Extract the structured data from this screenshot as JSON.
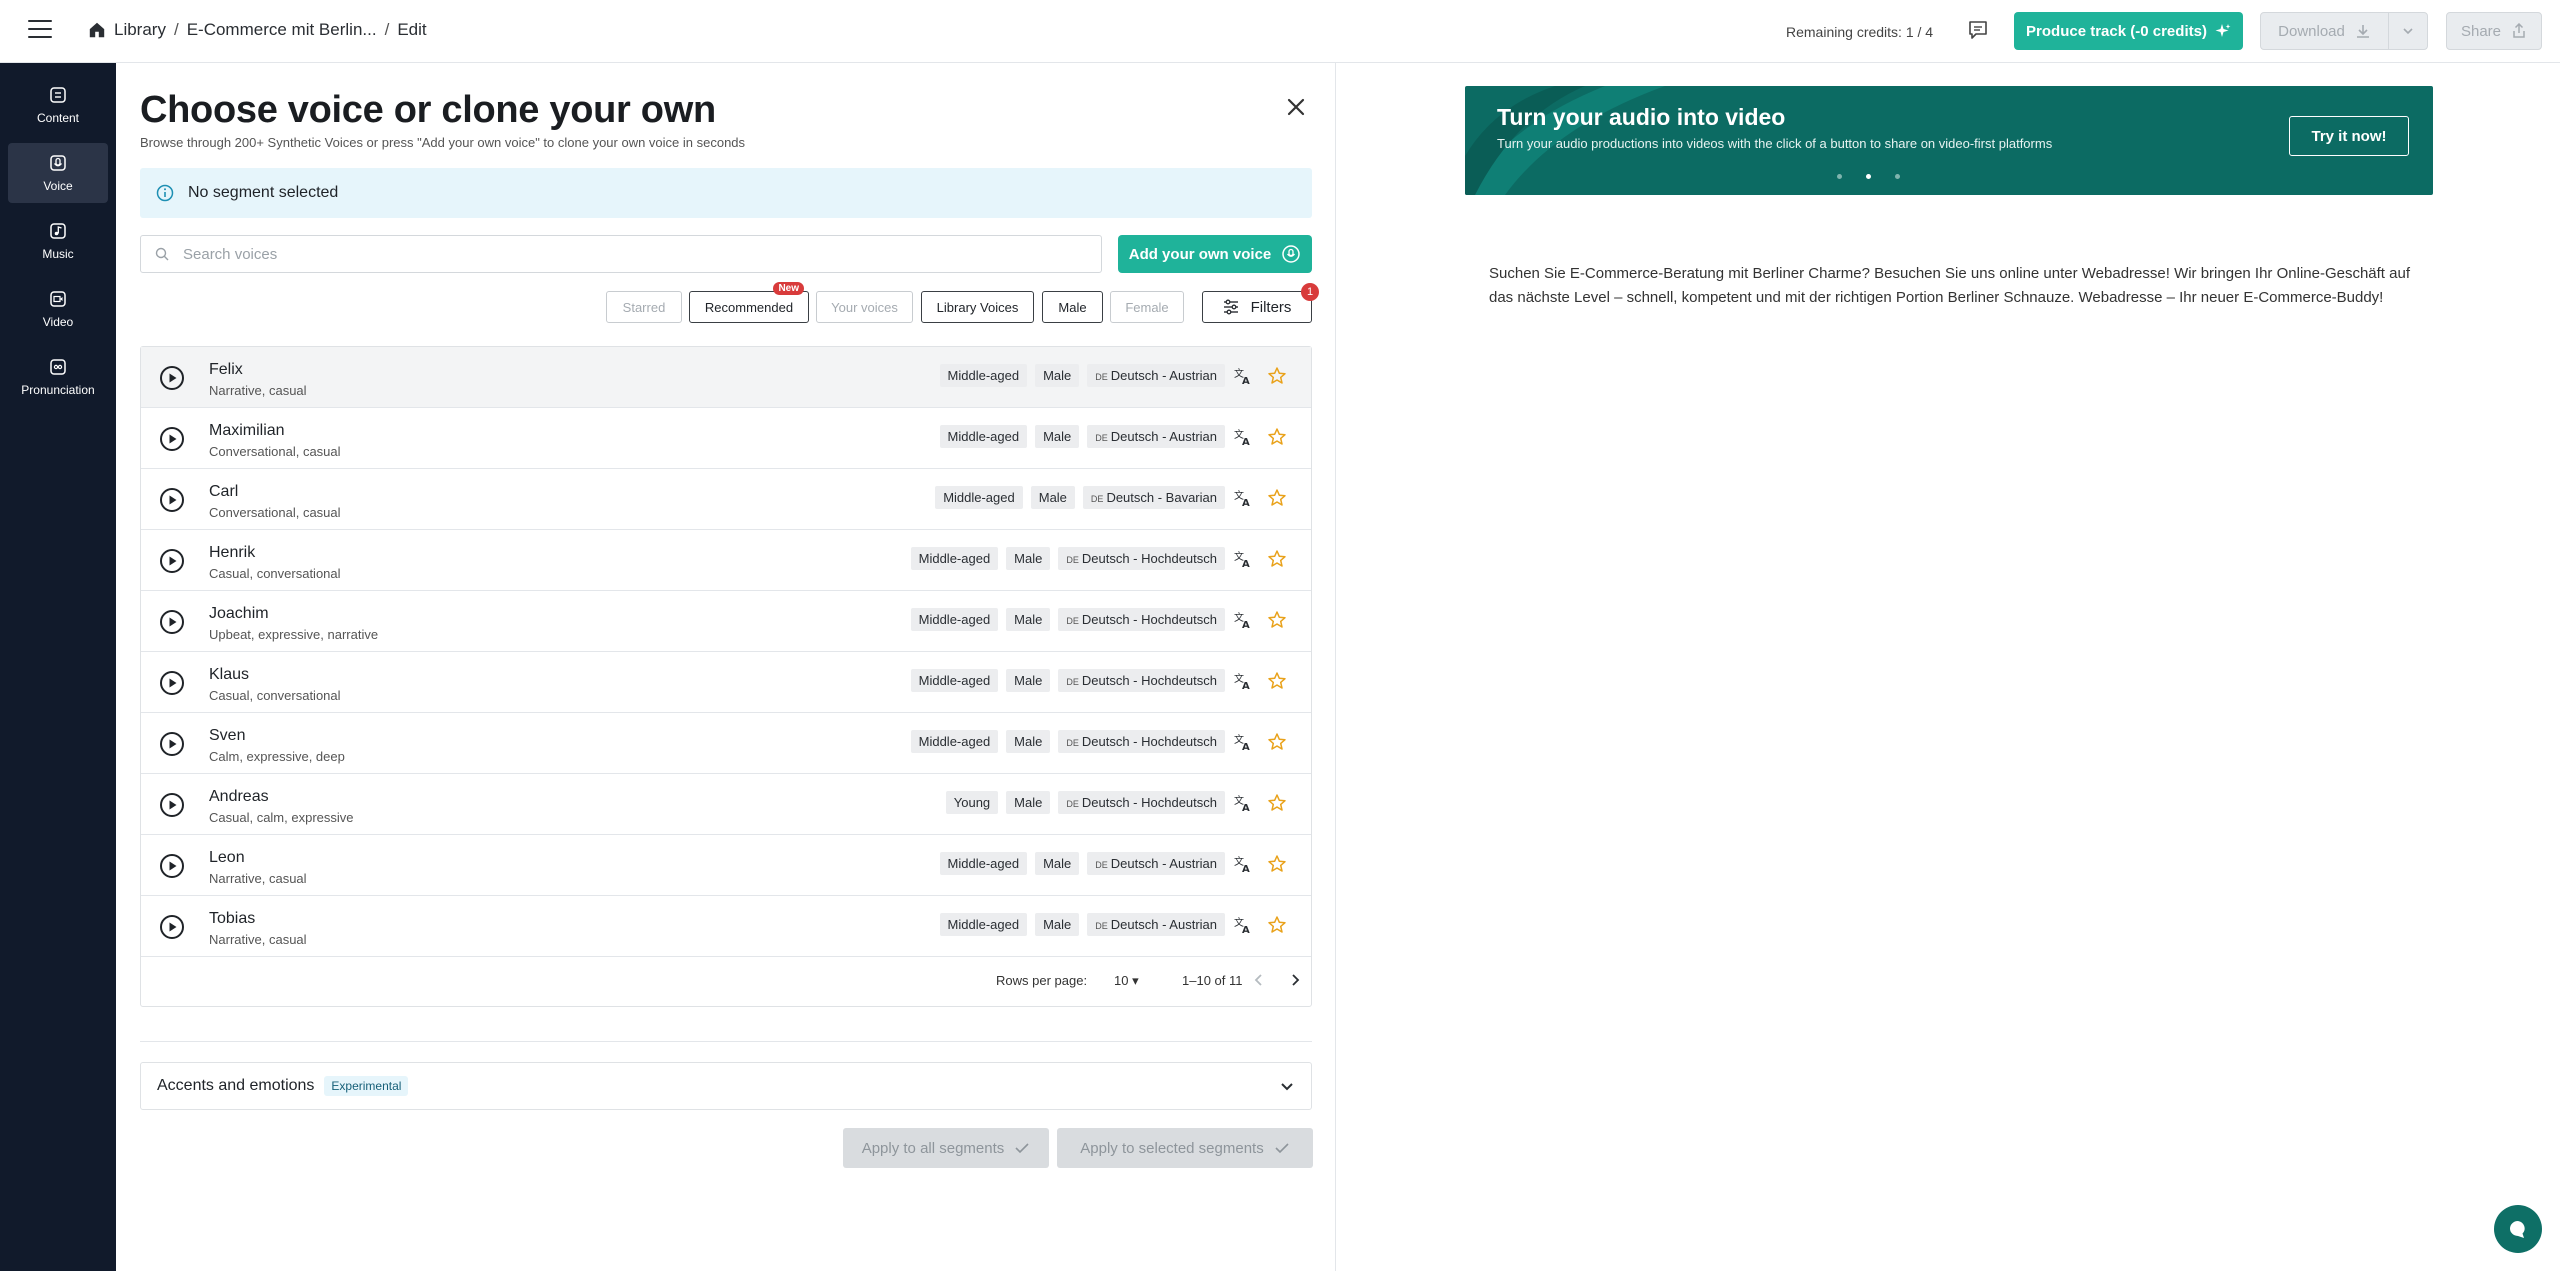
{
  "header": {
    "breadcrumb": [
      "Library",
      "E-Commerce mit Berlin...",
      "Edit"
    ],
    "credits": "Remaining credits: 1 / 4",
    "produce_label": "Produce track (-0 credits)",
    "download_label": "Download",
    "share_label": "Share"
  },
  "sidebar": {
    "items": [
      {
        "label": "Content",
        "icon": "content-icon"
      },
      {
        "label": "Voice",
        "icon": "voice-icon",
        "active": true
      },
      {
        "label": "Music",
        "icon": "music-icon"
      },
      {
        "label": "Video",
        "icon": "video-icon"
      },
      {
        "label": "Pronunciation",
        "icon": "pronunciation-icon"
      }
    ]
  },
  "panel": {
    "title": "Choose voice or clone your own",
    "subtitle": "Browse through 200+ Synthetic Voices or press \"Add your own voice\" to clone your own voice in seconds",
    "info": "No segment selected",
    "search_placeholder": "Search voices",
    "add_voice_label": "Add your own voice",
    "filter_chips": [
      {
        "label": "Starred",
        "enabled": false
      },
      {
        "label": "Recommended",
        "enabled": true,
        "badge": "New"
      },
      {
        "label": "Your voices",
        "enabled": false
      },
      {
        "label": "Library Voices",
        "enabled": true
      },
      {
        "label": "Male",
        "enabled": true
      },
      {
        "label": "Female",
        "enabled": false
      }
    ],
    "filters_label": "Filters",
    "filters_count": "1"
  },
  "voices": [
    {
      "name": "Felix",
      "desc": "Narrative, casual",
      "age": "Middle-aged",
      "gender": "Male",
      "flag": "DE",
      "lang": "Deutsch - Austrian"
    },
    {
      "name": "Maximilian",
      "desc": "Conversational, casual",
      "age": "Middle-aged",
      "gender": "Male",
      "flag": "DE",
      "lang": "Deutsch - Austrian"
    },
    {
      "name": "Carl",
      "desc": "Conversational, casual",
      "age": "Middle-aged",
      "gender": "Male",
      "flag": "DE",
      "lang": "Deutsch - Bavarian"
    },
    {
      "name": "Henrik",
      "desc": "Casual, conversational",
      "age": "Middle-aged",
      "gender": "Male",
      "flag": "DE",
      "lang": "Deutsch - Hochdeutsch"
    },
    {
      "name": "Joachim",
      "desc": "Upbeat, expressive, narrative",
      "age": "Middle-aged",
      "gender": "Male",
      "flag": "DE",
      "lang": "Deutsch - Hochdeutsch"
    },
    {
      "name": "Klaus",
      "desc": "Casual, conversational",
      "age": "Middle-aged",
      "gender": "Male",
      "flag": "DE",
      "lang": "Deutsch - Hochdeutsch"
    },
    {
      "name": "Sven",
      "desc": "Calm, expressive, deep",
      "age": "Middle-aged",
      "gender": "Male",
      "flag": "DE",
      "lang": "Deutsch - Hochdeutsch"
    },
    {
      "name": "Andreas",
      "desc": "Casual, calm, expressive",
      "age": "Young",
      "gender": "Male",
      "flag": "DE",
      "lang": "Deutsch - Hochdeutsch"
    },
    {
      "name": "Leon",
      "desc": "Narrative, casual",
      "age": "Middle-aged",
      "gender": "Male",
      "flag": "DE",
      "lang": "Deutsch - Austrian"
    },
    {
      "name": "Tobias",
      "desc": "Narrative, casual",
      "age": "Middle-aged",
      "gender": "Male",
      "flag": "DE",
      "lang": "Deutsch - Austrian"
    }
  ],
  "pager": {
    "rows_label": "Rows per page:",
    "rows_value": "10",
    "range": "1–10 of 11"
  },
  "accents": {
    "label": "Accents and emotions",
    "badge": "Experimental"
  },
  "apply": {
    "all_label": "Apply to all segments",
    "selected_label": "Apply to selected segments"
  },
  "promo": {
    "title": "Turn your audio into video",
    "subtitle": "Turn your audio productions into videos with the click of a button to share on video-first platforms",
    "cta": "Try it now!"
  },
  "script_text": "Suchen Sie E-Commerce-Beratung mit Berliner Charme? Besuchen Sie uns online unter Webadresse! Wir bringen Ihr Online-Geschäft auf das nächste Level – schnell, kompetent und mit der richtigen Portion Berliner Schnauze. Webadresse – Ihr neuer E-Commerce-Buddy!",
  "colors": {
    "accent": "#1fb39a",
    "sidebar": "#111a2b",
    "promo": "#0c6b63",
    "star": "#e9a21b",
    "badge": "#d83b3b"
  }
}
